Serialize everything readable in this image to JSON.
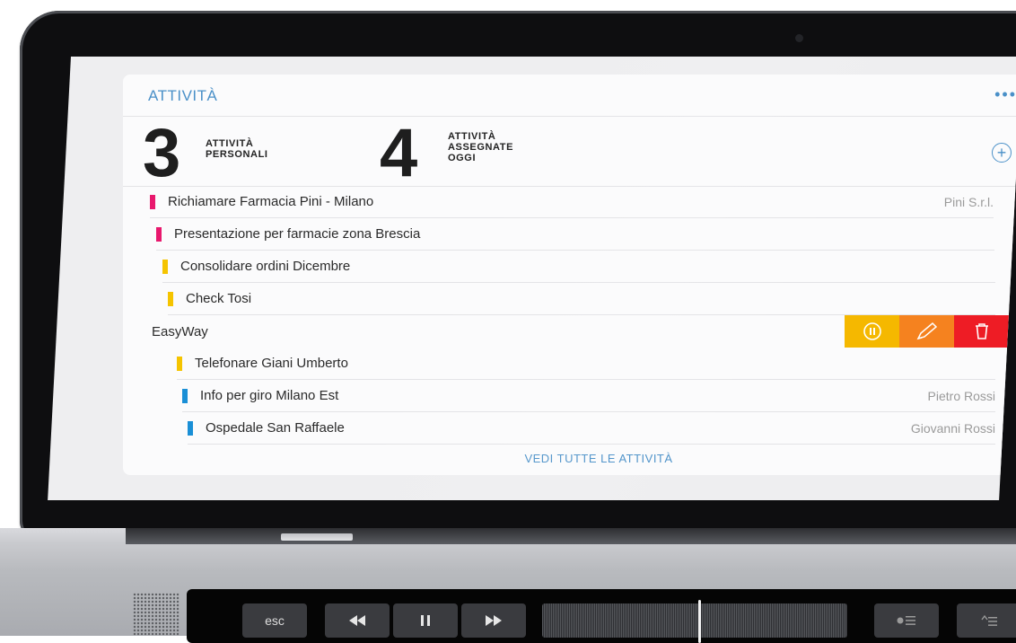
{
  "header": {
    "title": "ATTIVITÀ",
    "more_label": "•••"
  },
  "stats": {
    "personal_count": "3",
    "personal_label_1": "ATTIVITÀ",
    "personal_label_2": "PERSONALI",
    "assigned_count": "4",
    "assigned_label_1": "ATTIVITÀ",
    "assigned_label_2": "ASSEGNATE",
    "assigned_label_3": "OGGI",
    "add_icon": "plus-circle-icon"
  },
  "tasks": [
    {
      "label": "Richiamare Farmacia Pini - Milano",
      "company": "Pini S.r.l.",
      "color": "#e8186d"
    },
    {
      "label": "Presentazione per farmacie zona Brescia",
      "company": "",
      "color": "#e8186d"
    },
    {
      "label": "Consolidare ordini Dicembre",
      "company": "",
      "color": "#f5c400"
    },
    {
      "label": "Check Tosi",
      "company": "",
      "color": "#f5c400"
    },
    {
      "label": "EasyWay",
      "company": "",
      "color": ""
    },
    {
      "label": "Telefonare Giani Umberto",
      "company": "",
      "color": "#f5c400"
    },
    {
      "label": "Info per giro Milano Est",
      "company": "Pietro Rossi",
      "color": "#1a8fd6"
    },
    {
      "label": "Ospedale San Raffaele",
      "company": "Giovanni Rossi",
      "color": "#1a8fd6"
    }
  ],
  "row_actions": [
    {
      "icon": "pause-icon",
      "color": "#f5b800"
    },
    {
      "icon": "pencil-icon",
      "color": "#f5821f"
    },
    {
      "icon": "trash-icon",
      "color": "#ee1c25"
    }
  ],
  "footer": {
    "link": "VEDI TUTTE LE ATTIVITÀ"
  },
  "touchbar": {
    "esc": "esc"
  }
}
